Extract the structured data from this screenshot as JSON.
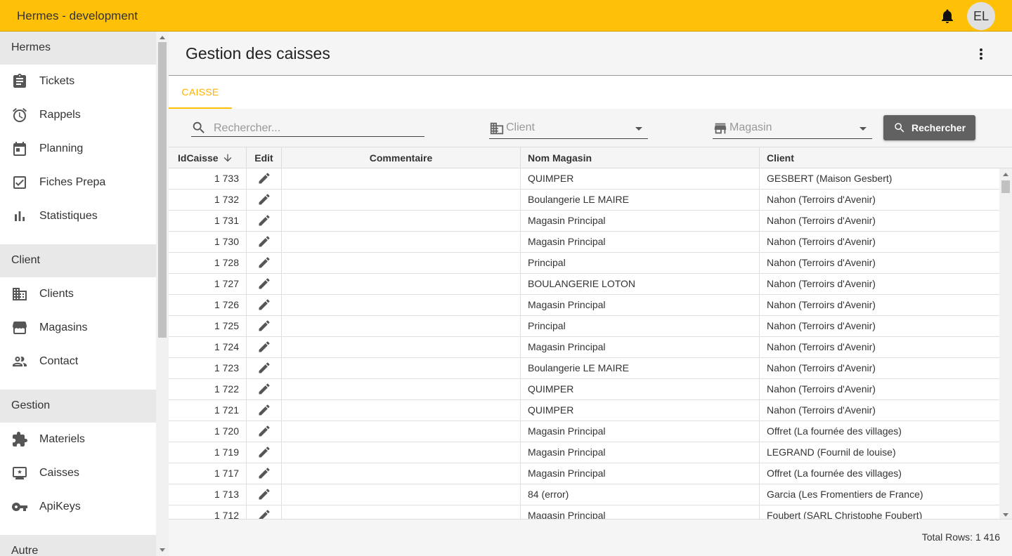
{
  "app": {
    "title": "Hermes - development",
    "avatar_initials": "EL",
    "accent": "#ffc107"
  },
  "sidebar": {
    "sections": [
      {
        "label": "Hermes",
        "items": [
          {
            "label": "Tickets",
            "icon": "clipboard-icon"
          },
          {
            "label": "Rappels",
            "icon": "alarm-icon"
          },
          {
            "label": "Planning",
            "icon": "calendar-icon"
          },
          {
            "label": "Fiches Prepa",
            "icon": "checklist-icon"
          },
          {
            "label": "Statistiques",
            "icon": "bar-chart-icon"
          }
        ]
      },
      {
        "label": "Client",
        "items": [
          {
            "label": "Clients",
            "icon": "building-icon"
          },
          {
            "label": "Magasins",
            "icon": "store-icon"
          },
          {
            "label": "Contact",
            "icon": "people-icon"
          }
        ]
      },
      {
        "label": "Gestion",
        "items": [
          {
            "label": "Materiels",
            "icon": "puzzle-icon"
          },
          {
            "label": "Caisses",
            "icon": "register-icon"
          },
          {
            "label": "ApiKeys",
            "icon": "key-icon"
          }
        ]
      },
      {
        "label": "Autre",
        "items": []
      }
    ]
  },
  "page": {
    "title": "Gestion des caisses",
    "tab": "CAISSE"
  },
  "filters": {
    "search_placeholder": "Rechercher...",
    "client_placeholder": "Client",
    "magasin_placeholder": "Magasin",
    "button_label": "Rechercher"
  },
  "grid": {
    "columns": [
      "IdCaisse",
      "Edit",
      "Commentaire",
      "Nom Magasin",
      "Client"
    ],
    "sort_column": "IdCaisse",
    "sort_direction": "descending",
    "rows": [
      {
        "id": "1 733",
        "commentaire": "",
        "magasin": "QUIMPER",
        "client": "GESBERT (Maison Gesbert)"
      },
      {
        "id": "1 732",
        "commentaire": "",
        "magasin": "Boulangerie LE MAIRE",
        "client": "Nahon (Terroirs d'Avenir)"
      },
      {
        "id": "1 731",
        "commentaire": "",
        "magasin": "Magasin Principal",
        "client": "Nahon (Terroirs d'Avenir)"
      },
      {
        "id": "1 730",
        "commentaire": "",
        "magasin": "Magasin Principal",
        "client": "Nahon (Terroirs d'Avenir)"
      },
      {
        "id": "1 728",
        "commentaire": "",
        "magasin": "Principal",
        "client": "Nahon (Terroirs d'Avenir)"
      },
      {
        "id": "1 727",
        "commentaire": "",
        "magasin": "BOULANGERIE LOTON",
        "client": "Nahon (Terroirs d'Avenir)"
      },
      {
        "id": "1 726",
        "commentaire": "",
        "magasin": "Magasin Principal",
        "client": "Nahon (Terroirs d'Avenir)"
      },
      {
        "id": "1 725",
        "commentaire": "",
        "magasin": "Principal",
        "client": "Nahon (Terroirs d'Avenir)"
      },
      {
        "id": "1 724",
        "commentaire": "",
        "magasin": "Magasin Principal",
        "client": "Nahon (Terroirs d'Avenir)"
      },
      {
        "id": "1 723",
        "commentaire": "",
        "magasin": "Boulangerie LE MAIRE",
        "client": "Nahon (Terroirs d'Avenir)"
      },
      {
        "id": "1 722",
        "commentaire": "",
        "magasin": "QUIMPER",
        "client": "Nahon (Terroirs d'Avenir)"
      },
      {
        "id": "1 721",
        "commentaire": "",
        "magasin": "QUIMPER",
        "client": "Nahon (Terroirs d'Avenir)"
      },
      {
        "id": "1 720",
        "commentaire": "",
        "magasin": "Magasin Principal",
        "client": "Offret (La fournée des villages)"
      },
      {
        "id": "1 719",
        "commentaire": "",
        "magasin": "Magasin Principal",
        "client": "LEGRAND (Fournil de louise)"
      },
      {
        "id": "1 717",
        "commentaire": "",
        "magasin": "Magasin Principal",
        "client": "Offret (La fournée des villages)"
      },
      {
        "id": "1 713",
        "commentaire": "",
        "magasin": "84 (error)",
        "client": "Garcia (Les Fromentiers de France)"
      },
      {
        "id": "1 712",
        "commentaire": "",
        "magasin": "Magasin Principal",
        "client": "Foubert (SARL Christophe Foubert)"
      }
    ]
  },
  "footer": {
    "total_rows": "Total Rows: 1 416"
  }
}
